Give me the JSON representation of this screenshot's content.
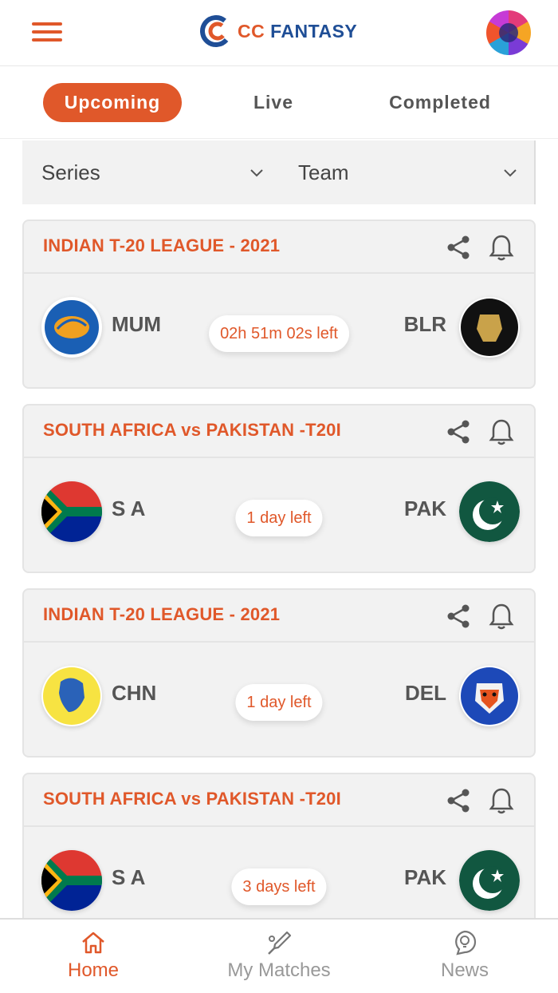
{
  "header": {
    "logo_cc": "CC",
    "logo_fantasy": "FANTASY",
    "avatar_icon": "user-avatar",
    "menu_icon": "hamburger-menu-icon"
  },
  "tabs": [
    {
      "label": "Upcoming",
      "active": true
    },
    {
      "label": "Live",
      "active": false
    },
    {
      "label": "Completed",
      "active": false
    }
  ],
  "filters": {
    "series_label": "Series",
    "team_label": "Team"
  },
  "matches": [
    {
      "series": "INDIAN T-20 LEAGUE - 2021",
      "home": {
        "code": "MUM",
        "logo": "mumbai-logo"
      },
      "away": {
        "code": "BLR",
        "logo": "bangalore-logo"
      },
      "time_left": "02h 51m 02s left"
    },
    {
      "series": "SOUTH AFRICA vs PAKISTAN -T20I",
      "home": {
        "code": "S A",
        "logo": "south-africa-flag"
      },
      "away": {
        "code": "PAK",
        "logo": "pakistan-flag"
      },
      "time_left": "1 day left"
    },
    {
      "series": "INDIAN T-20 LEAGUE - 2021",
      "home": {
        "code": "CHN",
        "logo": "chennai-logo"
      },
      "away": {
        "code": "DEL",
        "logo": "delhi-logo"
      },
      "time_left": "1 day left"
    },
    {
      "series": "SOUTH AFRICA vs PAKISTAN -T20I",
      "home": {
        "code": "S A",
        "logo": "south-africa-flag"
      },
      "away": {
        "code": "PAK",
        "logo": "pakistan-flag"
      },
      "time_left": "3 days left"
    }
  ],
  "bottom_nav": [
    {
      "label": "Home",
      "icon": "home-icon",
      "active": true
    },
    {
      "label": "My Matches",
      "icon": "cricket-bat-icon",
      "active": false
    },
    {
      "label": "News",
      "icon": "news-bulb-icon",
      "active": false
    }
  ],
  "colors": {
    "accent": "#e0582a",
    "brand_blue": "#1f4e96",
    "card_bg": "#f2f2f2"
  }
}
